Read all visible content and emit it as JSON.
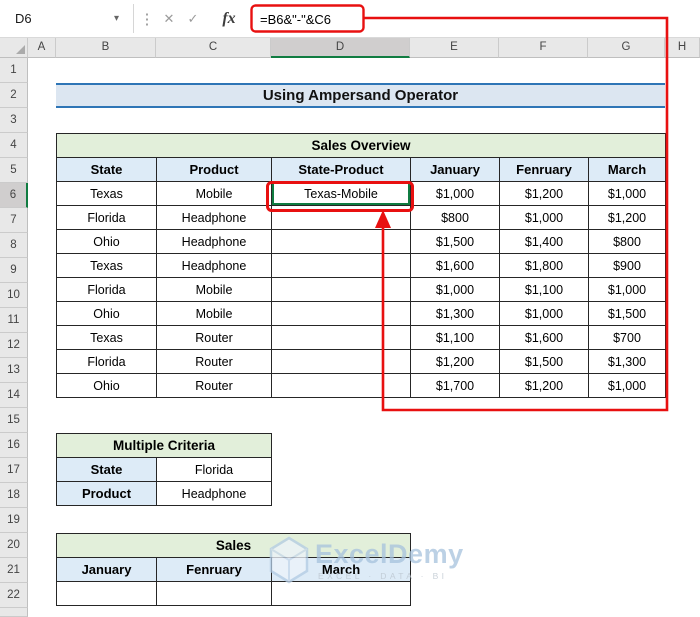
{
  "formula_bar": {
    "name_box": "D6",
    "formula": "=B6&\"-\"&C6"
  },
  "icons": {
    "chevron_down": "▾",
    "more_vertical": "⋮",
    "cancel": "✕",
    "check": "✓",
    "fx": "fx"
  },
  "grid": {
    "columns": [
      "A",
      "B",
      "C",
      "D",
      "E",
      "F",
      "G",
      "H"
    ],
    "rows": [
      "1",
      "2",
      "3",
      "4",
      "5",
      "6",
      "7",
      "8",
      "9",
      "10",
      "11",
      "12",
      "13",
      "14",
      "15",
      "16",
      "17",
      "18",
      "19",
      "20",
      "21",
      "22"
    ]
  },
  "title_banner": {
    "text": "Using Ampersand Operator"
  },
  "sales_table": {
    "title": "Sales Overview",
    "headers": [
      "State",
      "Product",
      "State-Product",
      "January",
      "Fenruary",
      "March"
    ],
    "rows": [
      [
        "Texas",
        "Mobile",
        "Texas-Mobile",
        "$1,000",
        "$1,200",
        "$1,000"
      ],
      [
        "Florida",
        "Headphone",
        "",
        "$800",
        "$1,000",
        "$1,200"
      ],
      [
        "Ohio",
        "Headphone",
        "",
        "$1,500",
        "$1,400",
        "$800"
      ],
      [
        "Texas",
        "Headphone",
        "",
        "$1,600",
        "$1,800",
        "$900"
      ],
      [
        "Florida",
        "Mobile",
        "",
        "$1,000",
        "$1,100",
        "$1,000"
      ],
      [
        "Ohio",
        "Mobile",
        "",
        "$1,300",
        "$1,000",
        "$1,500"
      ],
      [
        "Texas",
        "Router",
        "",
        "$1,100",
        "$1,600",
        "$700"
      ],
      [
        "Florida",
        "Router",
        "",
        "$1,200",
        "$1,500",
        "$1,300"
      ],
      [
        "Ohio",
        "Router",
        "",
        "$1,700",
        "$1,200",
        "$1,000"
      ]
    ]
  },
  "criteria_table": {
    "title": "Multiple Criteria",
    "rows": [
      [
        "State",
        "Florida"
      ],
      [
        "Product",
        "Headphone"
      ]
    ]
  },
  "sales_range": {
    "title": "Sales",
    "headers": [
      "January",
      "Fenruary",
      "March"
    ]
  },
  "watermark": {
    "name": "ExcelDemy",
    "tagline": "EXCEL · DATA · BI"
  },
  "colors": {
    "accent_green": "#107C41",
    "header_blue_fill": "#DDEBF7",
    "header_green_fill": "#E2EFDA",
    "title_fill": "#DCE6F1",
    "title_border": "#2E75B6",
    "annotation_red": "#E81010"
  }
}
